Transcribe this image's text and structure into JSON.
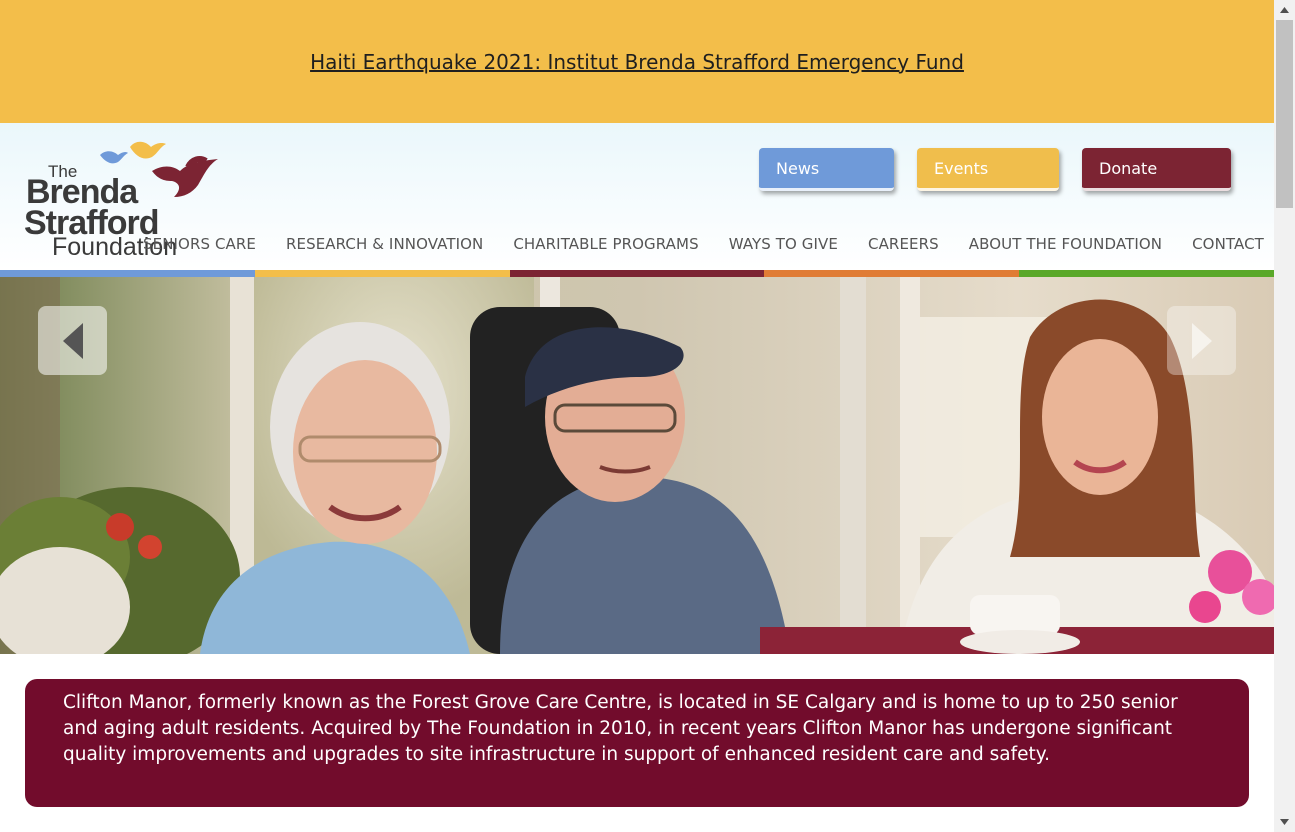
{
  "alert": {
    "link_text": "Haiti Earthquake 2021: Institut Brenda Strafford Emergency Fund"
  },
  "logo": {
    "line1": "The",
    "line2": "Brenda",
    "line3": "Strafford",
    "line4": "Foundation"
  },
  "top_buttons": {
    "news": "News",
    "events": "Events",
    "donate": "Donate"
  },
  "nav": {
    "items": [
      "SENIORS CARE",
      "RESEARCH & INNOVATION",
      "CHARITABLE PROGRAMS",
      "WAYS TO GIVE",
      "CAREERS",
      "ABOUT THE FOUNDATION",
      "CONTACT"
    ]
  },
  "colors": {
    "alert_bg": "#f3be4a",
    "news": "#6f9ad9",
    "events": "#f0be4c",
    "donate": "#7c2433",
    "caption_bg": "#720c2c",
    "strip": [
      "#6f9ad9",
      "#f3be4a",
      "#7c2433",
      "#e07c35",
      "#5aa829"
    ]
  },
  "hero": {
    "prev_icon": "triangle-left-icon",
    "next_icon": "triangle-right-icon"
  },
  "caption": {
    "text": "Clifton Manor, formerly known as the Forest Grove Care Centre, is located in SE Calgary and is home to up to 250 senior and aging adult residents. Acquired by The Foundation in 2010, in recent years Clifton Manor has undergone significant quality improvements and upgrades to site infrastructure in support of enhanced resident care and safety."
  }
}
